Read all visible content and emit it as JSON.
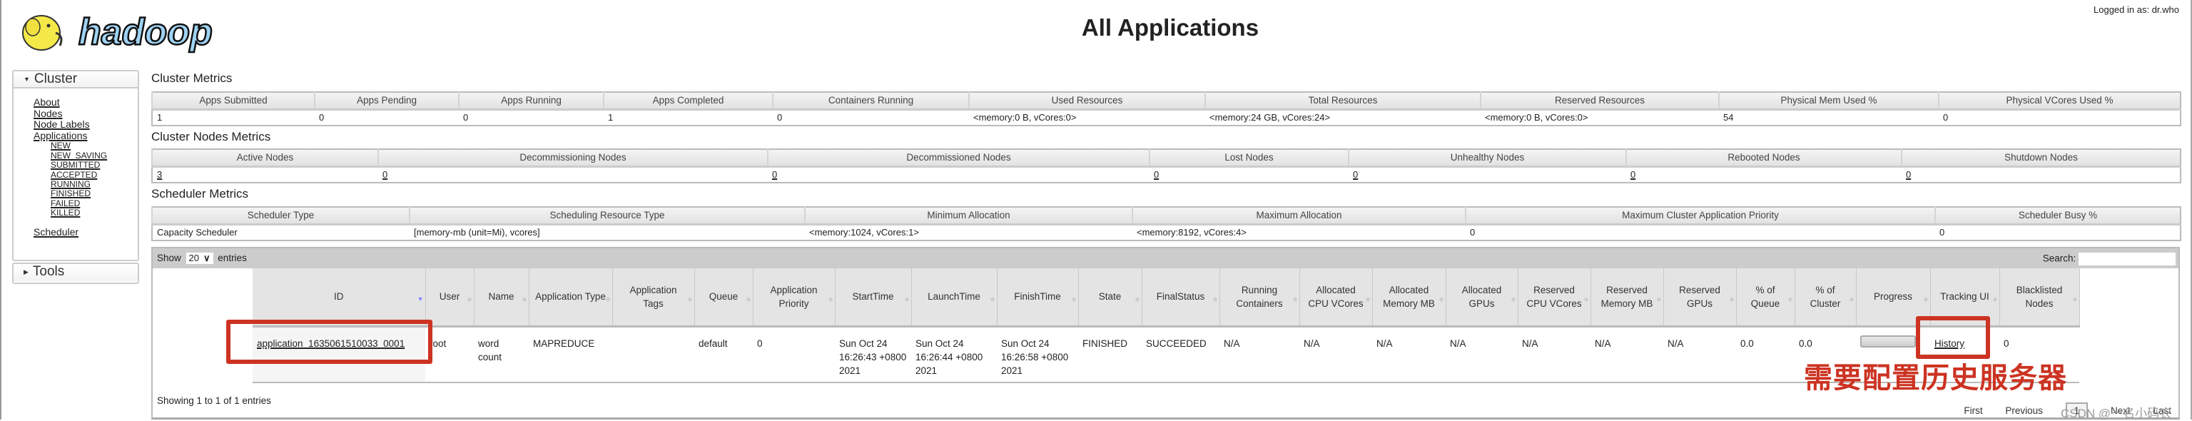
{
  "header": {
    "logo_text": "hadoop",
    "title": "All Applications",
    "logged_in": "Logged in as: dr.who"
  },
  "sidebar": {
    "cluster_label": "Cluster",
    "items": [
      "About",
      "Nodes",
      "Node Labels",
      "Applications"
    ],
    "app_states": [
      "NEW",
      "NEW_SAVING",
      "SUBMITTED",
      "ACCEPTED",
      "RUNNING",
      "FINISHED",
      "FAILED",
      "KILLED"
    ],
    "scheduler": "Scheduler",
    "tools_label": "Tools"
  },
  "cluster_metrics": {
    "title": "Cluster Metrics",
    "headers": [
      "Apps Submitted",
      "Apps Pending",
      "Apps Running",
      "Apps Completed",
      "Containers Running",
      "Used Resources",
      "Total Resources",
      "Reserved Resources",
      "Physical Mem Used %",
      "Physical VCores Used %"
    ],
    "values": [
      "1",
      "0",
      "0",
      "1",
      "0",
      "<memory:0 B, vCores:0>",
      "<memory:24 GB, vCores:24>",
      "<memory:0 B, vCores:0>",
      "54",
      "0"
    ]
  },
  "nodes_metrics": {
    "title": "Cluster Nodes Metrics",
    "headers": [
      "Active Nodes",
      "Decommissioning Nodes",
      "Decommissioned Nodes",
      "Lost Nodes",
      "Unhealthy Nodes",
      "Rebooted Nodes",
      "Shutdown Nodes"
    ],
    "values": [
      "3",
      "0",
      "0",
      "0",
      "0",
      "0",
      "0"
    ]
  },
  "scheduler_metrics": {
    "title": "Scheduler Metrics",
    "headers": [
      "Scheduler Type",
      "Scheduling Resource Type",
      "Minimum Allocation",
      "Maximum Allocation",
      "Maximum Cluster Application Priority",
      "Scheduler Busy %"
    ],
    "values": [
      "Capacity Scheduler",
      "[memory-mb (unit=Mi), vcores]",
      "<memory:1024, vCores:1>",
      "<memory:8192, vCores:4>",
      "0",
      "0"
    ]
  },
  "apps": {
    "show_label": "Show",
    "page_size": "20",
    "entries_label": "entries",
    "search_label": "Search:",
    "search_value": "",
    "headers": [
      "ID",
      "User",
      "Name",
      "Application Type",
      "Application Tags",
      "Queue",
      "Application Priority",
      "StartTime",
      "LaunchTime",
      "FinishTime",
      "State",
      "FinalStatus",
      "Running Containers",
      "Allocated CPU VCores",
      "Allocated Memory MB",
      "Allocated GPUs",
      "Reserved CPU VCores",
      "Reserved Memory MB",
      "Reserved GPUs",
      "% of Queue",
      "% of Cluster",
      "Progress",
      "Tracking UI",
      "Blacklisted Nodes"
    ],
    "rows": [
      {
        "id": "application_1635061510033_0001",
        "user": "root",
        "name": "word count",
        "type": "MAPREDUCE",
        "tags": "",
        "queue": "default",
        "priority": "0",
        "start": "Sun Oct 24 16:26:43 +0800 2021",
        "launch": "Sun Oct 24 16:26:44 +0800 2021",
        "finish": "Sun Oct 24 16:26:58 +0800 2021",
        "state": "FINISHED",
        "final_status": "SUCCEEDED",
        "running_containers": "N/A",
        "alloc_cpu": "N/A",
        "alloc_mem": "N/A",
        "alloc_gpu": "N/A",
        "res_cpu": "N/A",
        "res_mem": "N/A",
        "res_gpu": "N/A",
        "pct_queue": "0.0",
        "pct_cluster": "0.0",
        "tracking_ui": "History",
        "blacklisted": "0"
      }
    ],
    "showing": "Showing 1 to 1 of 1 entries",
    "pager": {
      "first": "First",
      "previous": "Previous",
      "current": "1",
      "next": "Next",
      "last": "Last"
    }
  },
  "annotation": {
    "note": "需要配置历史服务器",
    "color": "#cc3322"
  },
  "watermark": "CSDN @一名小码农"
}
